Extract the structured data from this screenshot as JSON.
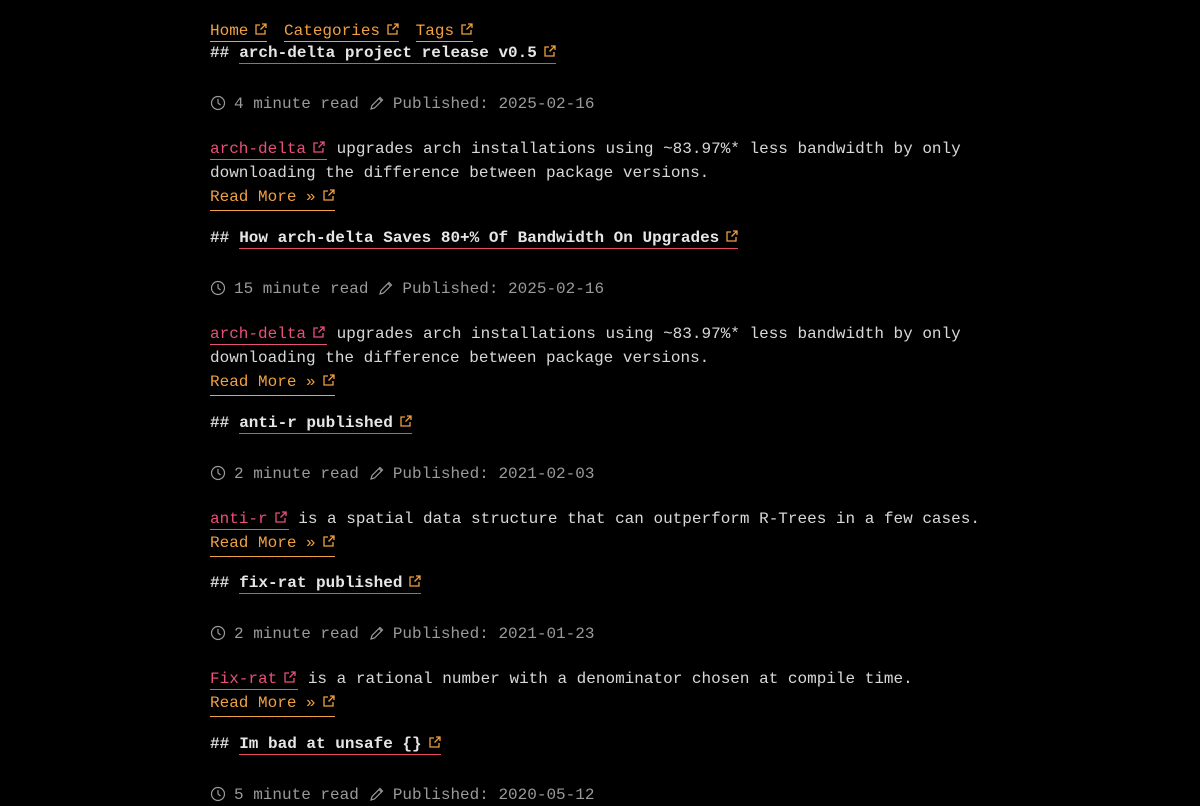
{
  "nav": {
    "home": "Home",
    "categories": "Categories",
    "tags": "Tags"
  },
  "colors": {
    "background": "#000000",
    "accent_orange": "#f0a040",
    "accent_pink": "#e8507a",
    "text": "#d8d8d8",
    "meta": "#9a9a9a"
  },
  "icons": {
    "external_link": "external-link-icon",
    "read_time": "clock-icon",
    "published": "pencil-icon"
  },
  "posts": [
    {
      "hash": "##",
      "title": "arch-delta project release v0.5",
      "read_time": "4 minute read",
      "published": "Published: 2025-02-16",
      "project": "arch-delta",
      "summary": "upgrades arch installations using ~83.97%* less bandwidth by only downloading the difference between package versions.",
      "read_more": "Read More »"
    },
    {
      "hash": "##",
      "title": "How arch-delta Saves 80+% Of Bandwidth On Upgrades",
      "read_time": "15 minute read",
      "published": "Published: 2025-02-16",
      "project": "arch-delta",
      "summary": "upgrades arch installations using ~83.97%* less bandwidth by only downloading the difference between package versions.",
      "read_more": "Read More »"
    },
    {
      "hash": "##",
      "title": "anti-r published",
      "read_time": "2 minute read",
      "published": "Published: 2021-02-03",
      "project": "anti-r",
      "summary": "is a spatial data structure that can outperform R-Trees in a few cases.",
      "read_more": "Read More »"
    },
    {
      "hash": "##",
      "title": "fix-rat published",
      "read_time": "2 minute read",
      "published": "Published: 2021-01-23",
      "project": "Fix-rat",
      "summary": "is a rational number with a denominator chosen at compile time.",
      "read_more": "Read More »"
    },
    {
      "hash": "##",
      "title": "Im bad at unsafe {}",
      "read_time": "5 minute read",
      "published": "Published: 2020-05-12"
    }
  ]
}
